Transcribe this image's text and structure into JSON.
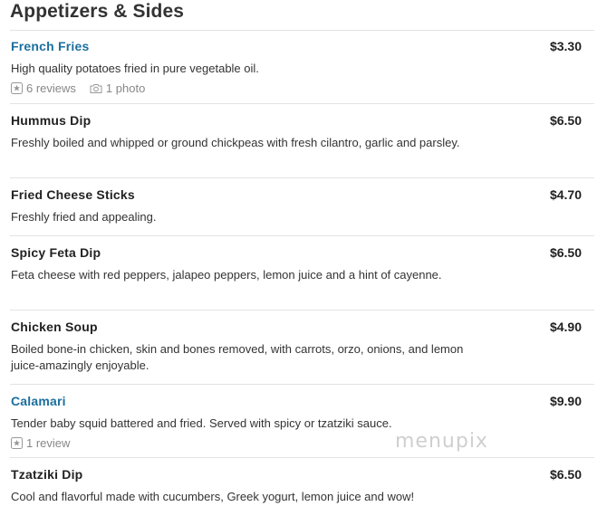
{
  "section": {
    "title": "Appetizers & Sides"
  },
  "items": [
    {
      "name": "French Fries",
      "price": "$3.30",
      "description": "High quality potatoes fried in pure vegetable oil.",
      "reviews": "6 reviews",
      "photos": "1 photo"
    },
    {
      "name": "Hummus Dip",
      "price": "$6.50",
      "description": "Freshly boiled and whipped or ground chickpeas with fresh cilantro, garlic and parsley."
    },
    {
      "name": "Fried Cheese Sticks",
      "price": "$4.70",
      "description": "Freshly fried and appealing."
    },
    {
      "name": "Spicy Feta Dip",
      "price": "$6.50",
      "description": "Feta cheese with red peppers, jalapeo peppers, lemon juice and a hint of cayenne."
    },
    {
      "name": "Chicken Soup",
      "price": "$4.90",
      "description": "Boiled bone-in chicken, skin and bones removed, with carrots, orzo, onions, and lemon juice-amazingly enjoyable."
    },
    {
      "name": "Calamari",
      "price": "$9.90",
      "description": "Tender baby squid battered and fried. Served with spicy or tzatziki sauce.",
      "reviews": "1 review"
    },
    {
      "name": "Tzatziki Dip",
      "price": "$6.50",
      "description": "Cool and flavorful made with cucumbers, Greek yogurt, lemon juice and wow!"
    }
  ],
  "watermark": "menupix",
  "colors": {
    "link": "#1b6f9e",
    "text": "#333333",
    "muted": "#888888",
    "rule": "#e3e3e3"
  },
  "icons": {
    "reviews": "star-badge-icon",
    "photos": "camera-icon"
  }
}
